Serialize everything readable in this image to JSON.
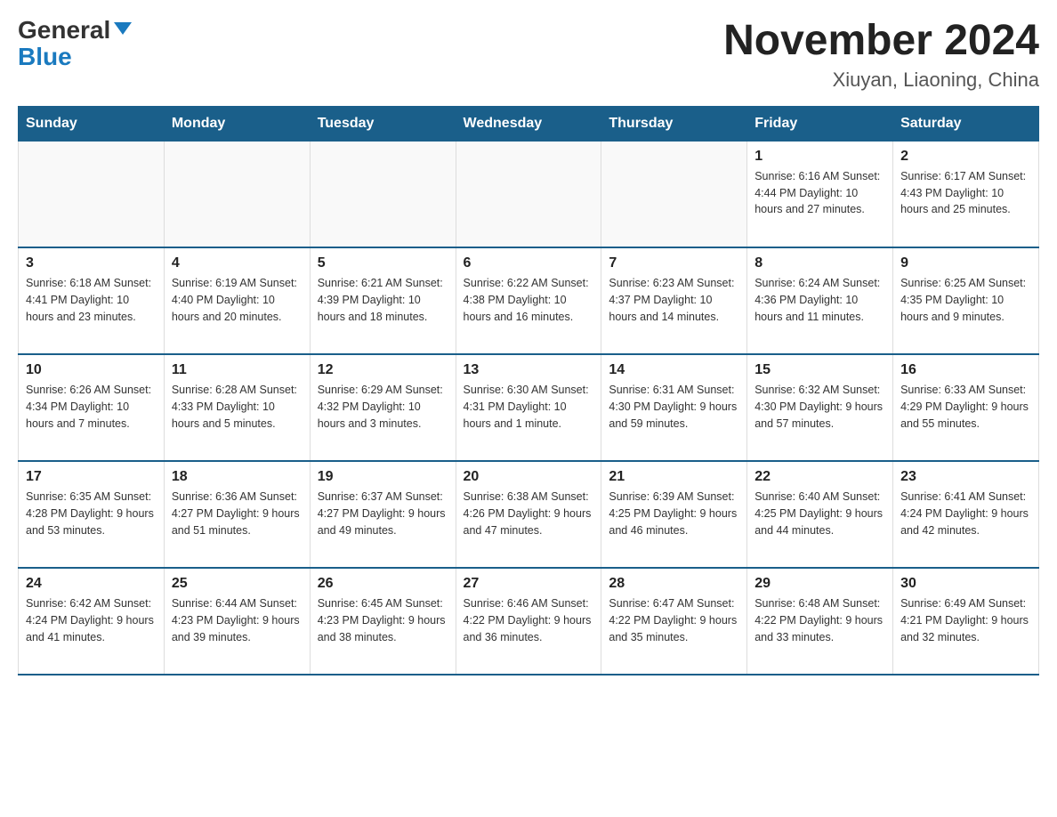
{
  "header": {
    "logo_general": "General",
    "logo_blue": "Blue",
    "month_title": "November 2024",
    "location": "Xiuyan, Liaoning, China"
  },
  "weekdays": [
    "Sunday",
    "Monday",
    "Tuesday",
    "Wednesday",
    "Thursday",
    "Friday",
    "Saturday"
  ],
  "weeks": [
    [
      {
        "day": "",
        "info": ""
      },
      {
        "day": "",
        "info": ""
      },
      {
        "day": "",
        "info": ""
      },
      {
        "day": "",
        "info": ""
      },
      {
        "day": "",
        "info": ""
      },
      {
        "day": "1",
        "info": "Sunrise: 6:16 AM\nSunset: 4:44 PM\nDaylight: 10 hours\nand 27 minutes."
      },
      {
        "day": "2",
        "info": "Sunrise: 6:17 AM\nSunset: 4:43 PM\nDaylight: 10 hours\nand 25 minutes."
      }
    ],
    [
      {
        "day": "3",
        "info": "Sunrise: 6:18 AM\nSunset: 4:41 PM\nDaylight: 10 hours\nand 23 minutes."
      },
      {
        "day": "4",
        "info": "Sunrise: 6:19 AM\nSunset: 4:40 PM\nDaylight: 10 hours\nand 20 minutes."
      },
      {
        "day": "5",
        "info": "Sunrise: 6:21 AM\nSunset: 4:39 PM\nDaylight: 10 hours\nand 18 minutes."
      },
      {
        "day": "6",
        "info": "Sunrise: 6:22 AM\nSunset: 4:38 PM\nDaylight: 10 hours\nand 16 minutes."
      },
      {
        "day": "7",
        "info": "Sunrise: 6:23 AM\nSunset: 4:37 PM\nDaylight: 10 hours\nand 14 minutes."
      },
      {
        "day": "8",
        "info": "Sunrise: 6:24 AM\nSunset: 4:36 PM\nDaylight: 10 hours\nand 11 minutes."
      },
      {
        "day": "9",
        "info": "Sunrise: 6:25 AM\nSunset: 4:35 PM\nDaylight: 10 hours\nand 9 minutes."
      }
    ],
    [
      {
        "day": "10",
        "info": "Sunrise: 6:26 AM\nSunset: 4:34 PM\nDaylight: 10 hours\nand 7 minutes."
      },
      {
        "day": "11",
        "info": "Sunrise: 6:28 AM\nSunset: 4:33 PM\nDaylight: 10 hours\nand 5 minutes."
      },
      {
        "day": "12",
        "info": "Sunrise: 6:29 AM\nSunset: 4:32 PM\nDaylight: 10 hours\nand 3 minutes."
      },
      {
        "day": "13",
        "info": "Sunrise: 6:30 AM\nSunset: 4:31 PM\nDaylight: 10 hours\nand 1 minute."
      },
      {
        "day": "14",
        "info": "Sunrise: 6:31 AM\nSunset: 4:30 PM\nDaylight: 9 hours\nand 59 minutes."
      },
      {
        "day": "15",
        "info": "Sunrise: 6:32 AM\nSunset: 4:30 PM\nDaylight: 9 hours\nand 57 minutes."
      },
      {
        "day": "16",
        "info": "Sunrise: 6:33 AM\nSunset: 4:29 PM\nDaylight: 9 hours\nand 55 minutes."
      }
    ],
    [
      {
        "day": "17",
        "info": "Sunrise: 6:35 AM\nSunset: 4:28 PM\nDaylight: 9 hours\nand 53 minutes."
      },
      {
        "day": "18",
        "info": "Sunrise: 6:36 AM\nSunset: 4:27 PM\nDaylight: 9 hours\nand 51 minutes."
      },
      {
        "day": "19",
        "info": "Sunrise: 6:37 AM\nSunset: 4:27 PM\nDaylight: 9 hours\nand 49 minutes."
      },
      {
        "day": "20",
        "info": "Sunrise: 6:38 AM\nSunset: 4:26 PM\nDaylight: 9 hours\nand 47 minutes."
      },
      {
        "day": "21",
        "info": "Sunrise: 6:39 AM\nSunset: 4:25 PM\nDaylight: 9 hours\nand 46 minutes."
      },
      {
        "day": "22",
        "info": "Sunrise: 6:40 AM\nSunset: 4:25 PM\nDaylight: 9 hours\nand 44 minutes."
      },
      {
        "day": "23",
        "info": "Sunrise: 6:41 AM\nSunset: 4:24 PM\nDaylight: 9 hours\nand 42 minutes."
      }
    ],
    [
      {
        "day": "24",
        "info": "Sunrise: 6:42 AM\nSunset: 4:24 PM\nDaylight: 9 hours\nand 41 minutes."
      },
      {
        "day": "25",
        "info": "Sunrise: 6:44 AM\nSunset: 4:23 PM\nDaylight: 9 hours\nand 39 minutes."
      },
      {
        "day": "26",
        "info": "Sunrise: 6:45 AM\nSunset: 4:23 PM\nDaylight: 9 hours\nand 38 minutes."
      },
      {
        "day": "27",
        "info": "Sunrise: 6:46 AM\nSunset: 4:22 PM\nDaylight: 9 hours\nand 36 minutes."
      },
      {
        "day": "28",
        "info": "Sunrise: 6:47 AM\nSunset: 4:22 PM\nDaylight: 9 hours\nand 35 minutes."
      },
      {
        "day": "29",
        "info": "Sunrise: 6:48 AM\nSunset: 4:22 PM\nDaylight: 9 hours\nand 33 minutes."
      },
      {
        "day": "30",
        "info": "Sunrise: 6:49 AM\nSunset: 4:21 PM\nDaylight: 9 hours\nand 32 minutes."
      }
    ]
  ]
}
